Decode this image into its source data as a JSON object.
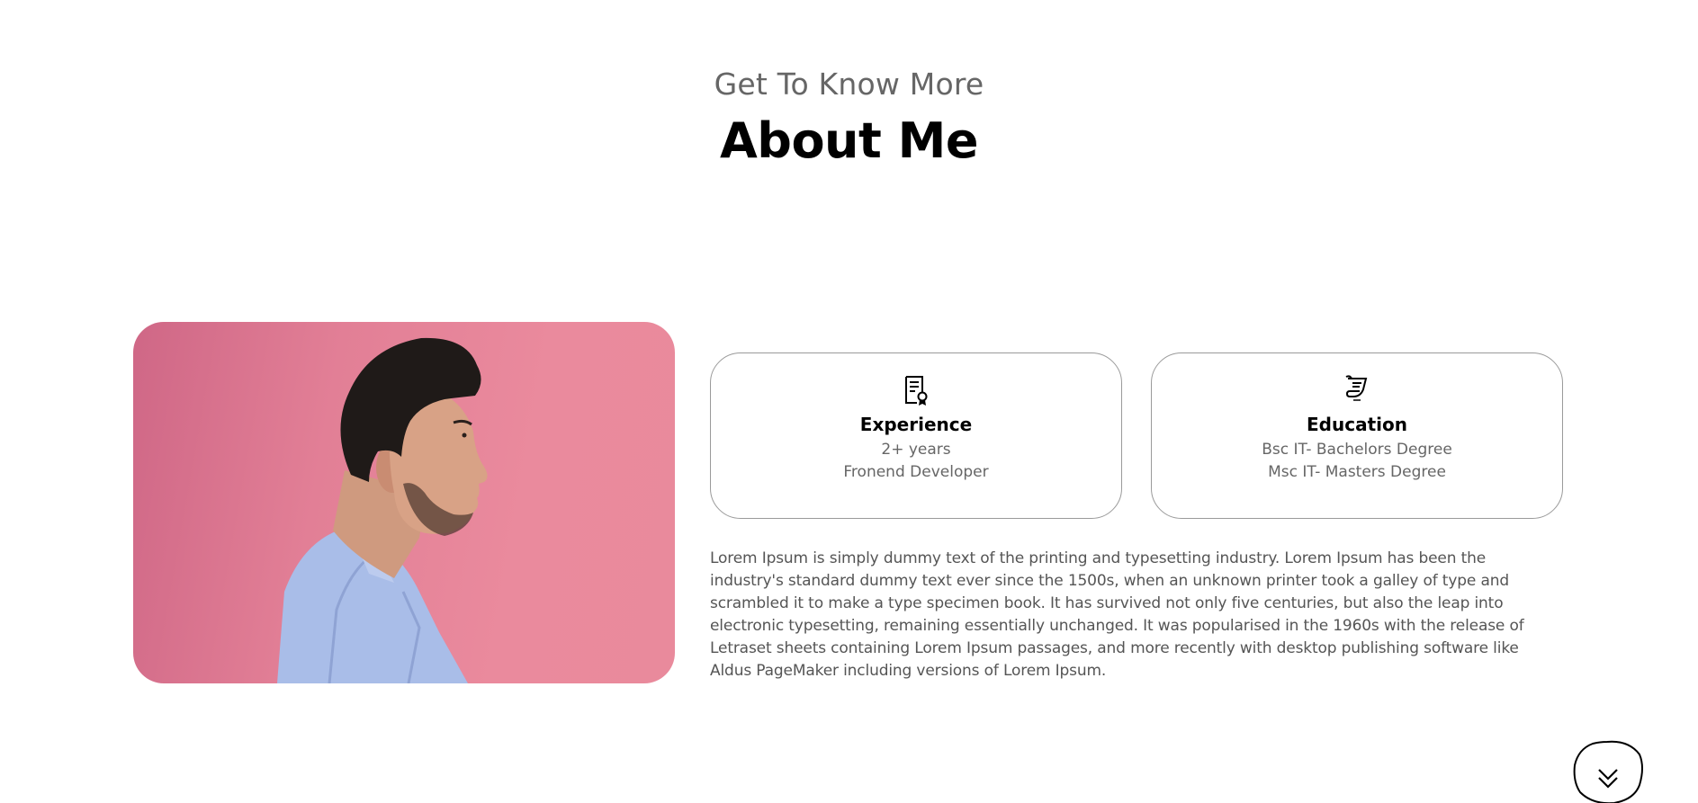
{
  "section": {
    "subtitle": "Get To Know More",
    "title": "About Me"
  },
  "cards": {
    "experience": {
      "icon": "certificate-icon",
      "title": "Experience",
      "line1": "2+ years",
      "line2": "Fronend Developer"
    },
    "education": {
      "icon": "graduation-scroll-icon",
      "title": "Education",
      "line1": "Bsc IT- Bachelors Degree",
      "line2": "Msc IT- Masters Degree"
    }
  },
  "bio": "Lorem Ipsum is simply dummy text of the printing and typesetting industry. Lorem Ipsum has been the industry's standard dummy text ever since the 1500s, when an unknown printer took a galley of type and scrambled it to make a type specimen book. It has survived not only five centuries, but also the leap into electronic typesetting, remaining essentially unchanged. It was popularised in the 1960s with the release of Letraset sheets containing Lorem Ipsum passages, and more recently with desktop publishing software like Aldus PageMaker including versions of Lorem Ipsum.",
  "scroll_button": {
    "icon": "chevron-double-down-icon"
  },
  "colors": {
    "portrait_background": "#e8889c",
    "text_muted": "#666666",
    "card_border": "#9a9a9a"
  }
}
